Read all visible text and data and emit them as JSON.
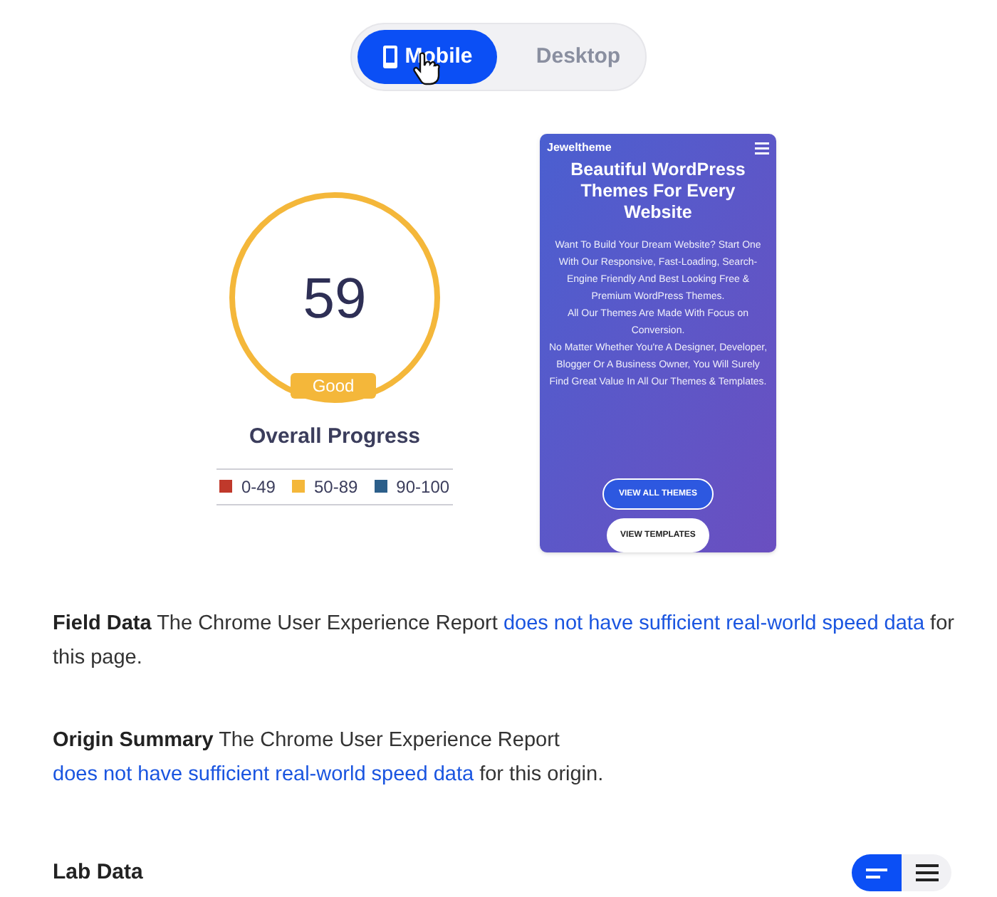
{
  "device_tabs": [
    {
      "label": "Mobile",
      "kind": "mobile",
      "selected": true
    },
    {
      "label": "Desktop",
      "kind": "desktop",
      "selected": false
    }
  ],
  "score": {
    "value": "59",
    "rating": "Good",
    "caption": "Overall Progress",
    "color": "#f4b73a",
    "legend": [
      {
        "label": "0-49",
        "color": "#c0392b"
      },
      {
        "label": "50-89",
        "color": "#f4b73a"
      },
      {
        "label": "90-100",
        "color": "#2c5f8a"
      }
    ]
  },
  "preview": {
    "logo": "Jeweltheme",
    "heading": "Beautiful WordPress Themes For Every Website",
    "paragraphs": [
      "Want To Build Your Dream Website? Start One With Our Responsive, Fast-Loading, Search-Engine Friendly And Best Looking Free & Premium WordPress Themes.",
      "All Our Themes Are Made With Focus on Conversion.",
      "No Matter Whether You're A Designer, Developer, Blogger Or A Business Owner, You Will Surely Find Great Value In All Our Themes & Templates."
    ],
    "buttons": [
      {
        "label": "VIEW ALL THEMES",
        "kind": "outline"
      },
      {
        "label": "VIEW TEMPLATES",
        "kind": "solid"
      }
    ]
  },
  "sections": [
    {
      "title": "Field Data",
      "text": "The Chrome User Experience Report",
      "link": "does not have sufficient real-world speed data",
      "after": "for this page."
    },
    {
      "title": "Origin Summary",
      "text": "The Chrome User Experience Report",
      "link": "does not have sufficient real-world speed data",
      "after": "for this origin."
    }
  ],
  "lab": {
    "title": "Lab Data",
    "views": [
      {
        "kind": "summary",
        "selected": true
      },
      {
        "kind": "list",
        "selected": false
      }
    ]
  }
}
